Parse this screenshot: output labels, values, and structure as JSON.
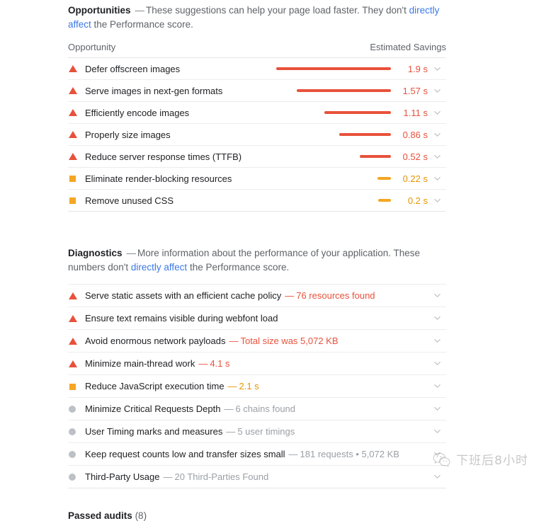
{
  "opportunities": {
    "heading": "Opportunities",
    "dash": "—",
    "description_before": "These suggestions can help your page load faster. They don't ",
    "link_text": "directly affect",
    "description_after": " the Performance score.",
    "col_opportunity": "Opportunity",
    "col_savings": "Estimated Savings",
    "rows": [
      {
        "severity": "fail",
        "title": "Defer offscreen images",
        "savings": "1.9 s",
        "bar_pct": 100
      },
      {
        "severity": "fail",
        "title": "Serve images in next-gen formats",
        "savings": "1.57 s",
        "bar_pct": 82
      },
      {
        "severity": "fail",
        "title": "Efficiently encode images",
        "savings": "1.11 s",
        "bar_pct": 58
      },
      {
        "severity": "fail",
        "title": "Properly size images",
        "savings": "0.86 s",
        "bar_pct": 45
      },
      {
        "severity": "fail",
        "title": "Reduce server response times (TTFB)",
        "savings": "0.52 s",
        "bar_pct": 27
      },
      {
        "severity": "average",
        "title": "Eliminate render-blocking resources",
        "savings": "0.22 s",
        "bar_pct": 12
      },
      {
        "severity": "average",
        "title": "Remove unused CSS",
        "savings": "0.2 s",
        "bar_pct": 11
      }
    ]
  },
  "diagnostics": {
    "heading": "Diagnostics",
    "dash": "—",
    "description_before": "More information about the performance of your application. These numbers don't ",
    "link_text": "directly affect",
    "description_after": " the Performance score.",
    "rows": [
      {
        "severity": "fail",
        "title": "Serve static assets with an efficient cache policy",
        "value": "76 resources found"
      },
      {
        "severity": "fail",
        "title": "Ensure text remains visible during webfont load",
        "value": ""
      },
      {
        "severity": "fail",
        "title": "Avoid enormous network payloads",
        "value": "Total size was 5,072 KB"
      },
      {
        "severity": "fail",
        "title": "Minimize main-thread work",
        "value": "4.1 s"
      },
      {
        "severity": "average",
        "title": "Reduce JavaScript execution time",
        "value": "2.1 s"
      },
      {
        "severity": "info",
        "title": "Minimize Critical Requests Depth",
        "value": "6 chains found"
      },
      {
        "severity": "info",
        "title": "User Timing marks and measures",
        "value": "5 user timings"
      },
      {
        "severity": "info",
        "title": "Keep request counts low and transfer sizes small",
        "value": "181 requests • 5,072 KB"
      },
      {
        "severity": "info",
        "title": "Third-Party Usage",
        "value": "20 Third-Parties Found"
      }
    ]
  },
  "passed_audits": {
    "label": "Passed audits",
    "count": "(8)"
  },
  "watermark": {
    "text": "下班后8小时"
  },
  "colors": {
    "fail": "#e8513b",
    "average": "#f5a623",
    "info": "#bdc1c6",
    "link": "#3b78e7"
  }
}
